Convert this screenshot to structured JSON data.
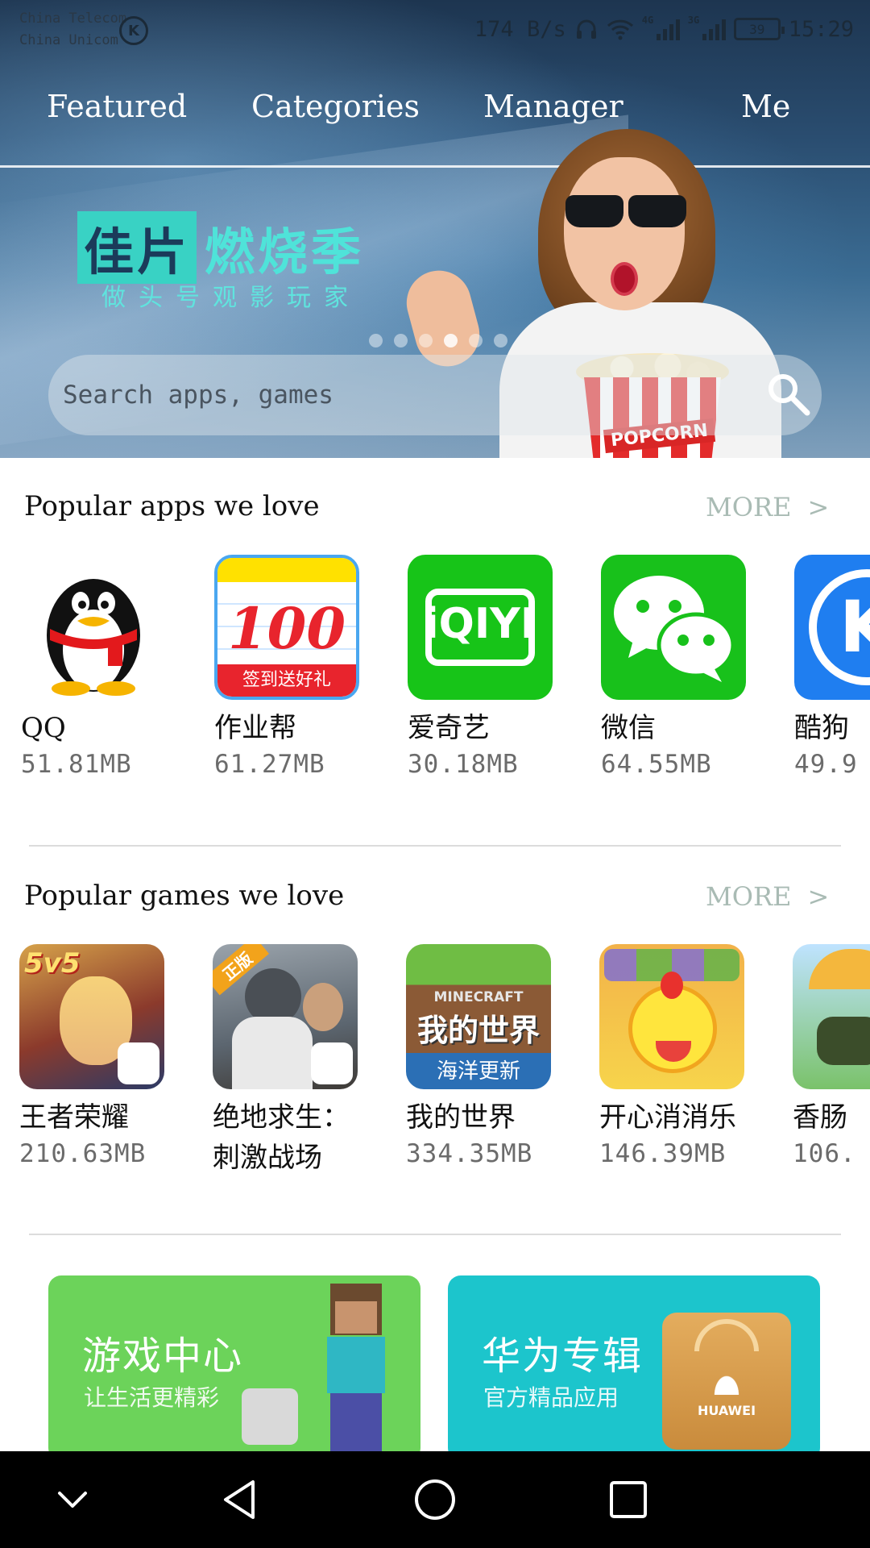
{
  "status_bar": {
    "carrier_1": "China Telecom",
    "carrier_2": "China Unicom",
    "net_speed": "174 B/s",
    "network_1": "4G",
    "network_2": "3G",
    "battery": "39",
    "time": "15:29"
  },
  "top_nav": {
    "tabs": [
      {
        "label": "Featured"
      },
      {
        "label": "Categories"
      },
      {
        "label": "Manager"
      },
      {
        "label": "Me"
      }
    ]
  },
  "banner": {
    "title_highlight": "佳片",
    "title_rest": "燃烧季",
    "subtitle": "做头号观影玩家",
    "popcorn_label": "POPCORN",
    "slide_index": 4,
    "slide_count": 6
  },
  "search": {
    "placeholder": "Search apps, games"
  },
  "apps_section": {
    "title": "Popular apps we love",
    "more_label": "MORE",
    "more_chevron": ">",
    "items": [
      {
        "name": "QQ",
        "size": "51.81MB",
        "icon": "qq-penguin-icon"
      },
      {
        "name": "作业帮",
        "size": "61.27MB",
        "icon": "zuoyebang-100-icon",
        "icon_text": "100",
        "icon_subtext": "签到送好礼"
      },
      {
        "name": "爱奇艺",
        "size": "30.18MB",
        "icon": "iqiyi-icon",
        "icon_text": "iQIYI"
      },
      {
        "name": "微信",
        "size": "64.55MB",
        "icon": "wechat-icon"
      },
      {
        "name": "酷狗",
        "size": "49.9",
        "icon": "kugou-icon",
        "icon_text": "K"
      }
    ]
  },
  "games_section": {
    "title": "Popular games we love",
    "more_label": "MORE",
    "more_chevron": ">",
    "items": [
      {
        "name": "王者荣耀",
        "size": "210.63MB",
        "icon": "honor-of-kings-icon",
        "icon_text": "5v5"
      },
      {
        "name": "绝地求生：刺激战场",
        "size": "",
        "icon": "pubg-icon",
        "icon_text": "正版"
      },
      {
        "name": "我的世界",
        "size": "334.35MB",
        "icon": "minecraft-icon",
        "icon_text": "我的世界",
        "icon_subtext": "海洋更新",
        "icon_top": "MINECRAFT"
      },
      {
        "name": "开心消消乐",
        "size": "146.39MB",
        "icon": "happy-elimination-icon"
      },
      {
        "name": "香肠",
        "size": "106.",
        "icon": "sausage-party-icon"
      }
    ]
  },
  "promos": [
    {
      "title": "游戏中心",
      "subtitle": "让生活更精彩",
      "color": "#6cd35a"
    },
    {
      "title": "华为专辑",
      "subtitle": "官方精品应用",
      "color": "#1cc5cc",
      "badge": "HUAWEI"
    }
  ],
  "colors": {
    "more": "#a9bbb4",
    "banner_text": "#4fe3d9",
    "nav_bar": "#000000"
  }
}
